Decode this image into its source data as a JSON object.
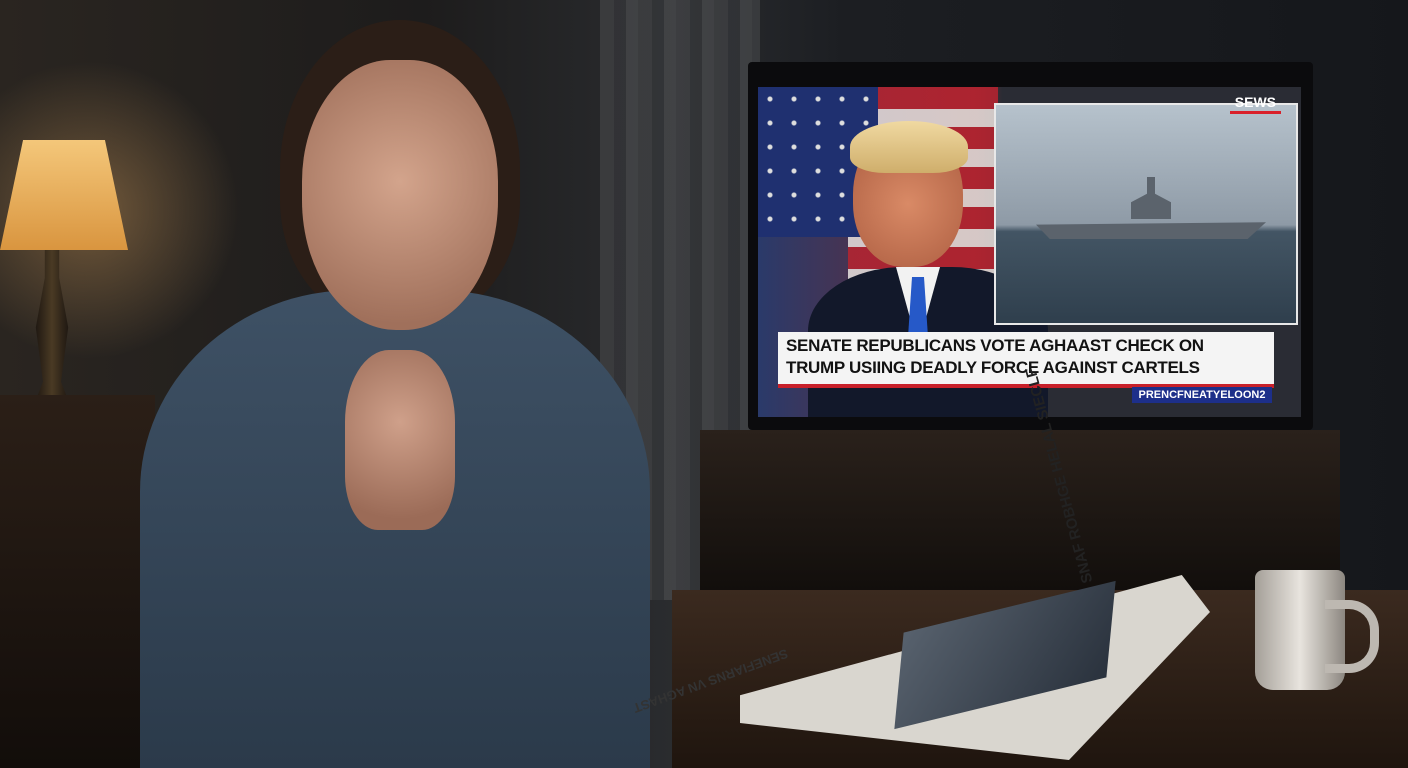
{
  "tv": {
    "network_logo": "SEWS",
    "headline": "SENATE REPUBLICANS VOTE AGHAAST CHECK ON\nTRUMP USIING DEADLY FORCE AGAINST CARTELS",
    "ticker": "PRENCFNEATYELOON2"
  },
  "newspaper": {
    "headline": "SNAF ROBHGE HELAL SIECLF",
    "subhead": "SENEFIARNS VN AGHAST"
  },
  "colors": {
    "ticker_band": "#1d2f8a",
    "headline_rule": "#c8202a",
    "lamp_glow": "#f4c77a"
  }
}
